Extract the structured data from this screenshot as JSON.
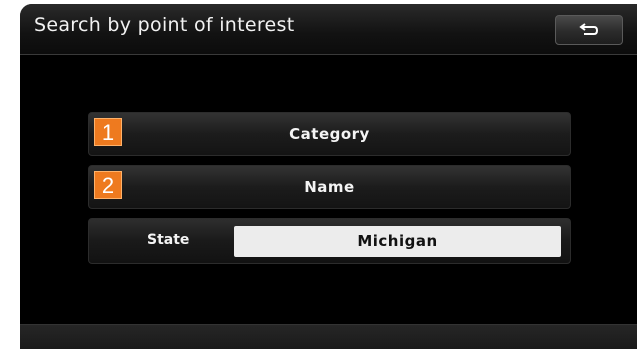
{
  "header": {
    "title": "Search by point of interest",
    "back_icon": "back-arrow-icon"
  },
  "menu": {
    "items": [
      {
        "number": "1",
        "label": "Category"
      },
      {
        "number": "2",
        "label": "Name"
      }
    ],
    "state": {
      "label": "State",
      "value": "Michigan"
    }
  },
  "colors": {
    "background": "#000000",
    "badge": "#ee7a1f",
    "text": "#f4f4f4",
    "state_field": "#ececec"
  }
}
